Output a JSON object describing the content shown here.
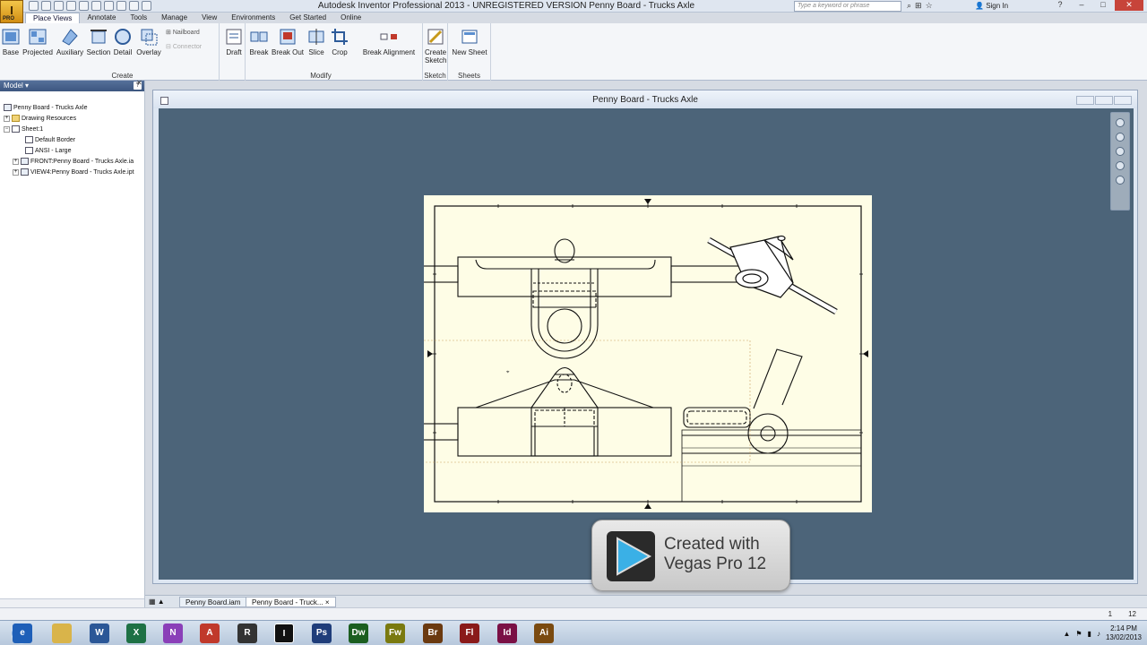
{
  "app": {
    "logo_letter": "I",
    "logo_badge": "PRO",
    "window_title": "Autodesk Inventor Professional 2013 - UNREGISTERED VERSION   Penny Board - Trucks Axle",
    "search_placeholder": "Type a keyword or phrase",
    "signin_label": "Sign In",
    "help_label": "?",
    "win_min": "–",
    "win_max": "□",
    "win_close": "✕"
  },
  "ribbon_tabs": [
    "Place Views",
    "Annotate",
    "Tools",
    "Manage",
    "View",
    "Environments",
    "Get Started",
    "Online"
  ],
  "ribbon": {
    "create": {
      "label": "Create",
      "buttons": [
        "Base",
        "Projected",
        "Auxiliary",
        "Section",
        "Detail",
        "Overlay"
      ],
      "small": [
        "Nailboard",
        "Connector"
      ]
    },
    "modify": {
      "label": "Modify",
      "buttons": [
        "Draft",
        "Break",
        "Break Out",
        "Slice",
        "Crop",
        "Break Alignment"
      ]
    },
    "sketch": {
      "label": "Sketch",
      "button_line1": "Create",
      "button_line2": "Sketch"
    },
    "sheets": {
      "label": "Sheets",
      "button": "New Sheet"
    }
  },
  "browser": {
    "header": "Model ▾",
    "help": "?",
    "close": "✕",
    "items": [
      "Penny Board - Trucks Axle",
      "Drawing Resources",
      "Sheet:1",
      "Default Border",
      "ANSI - Large",
      "FRONT:Penny Board - Trucks Axle.ia",
      "VIEW4:Penny Board - Trucks Axle.ipt"
    ]
  },
  "drawing_window": {
    "title": "Penny Board - Trucks Axle"
  },
  "watermark": {
    "line1": "Created with",
    "line2": "Vegas Pro 12"
  },
  "doc_tabs": [
    "Penny Board.iam",
    "Penny Board - Truck..."
  ],
  "status": {
    "left": "1",
    "right": "12"
  },
  "taskbar": {
    "apps": [
      "Ps",
      "Dw",
      "Fw",
      "Br",
      "Fl",
      "Id",
      "Ai"
    ],
    "app_colors": [
      "#1f3d7a",
      "#1b5e20",
      "#7a7a10",
      "#6b3a10",
      "#8a1a1a",
      "#7a1045",
      "#7a4a10"
    ],
    "time": "2:14 PM",
    "date": "13/02/2013"
  },
  "colors": {
    "canvas": "#4c6479",
    "sheet": "#fefde6",
    "ribbon": "#f4f6f9"
  }
}
